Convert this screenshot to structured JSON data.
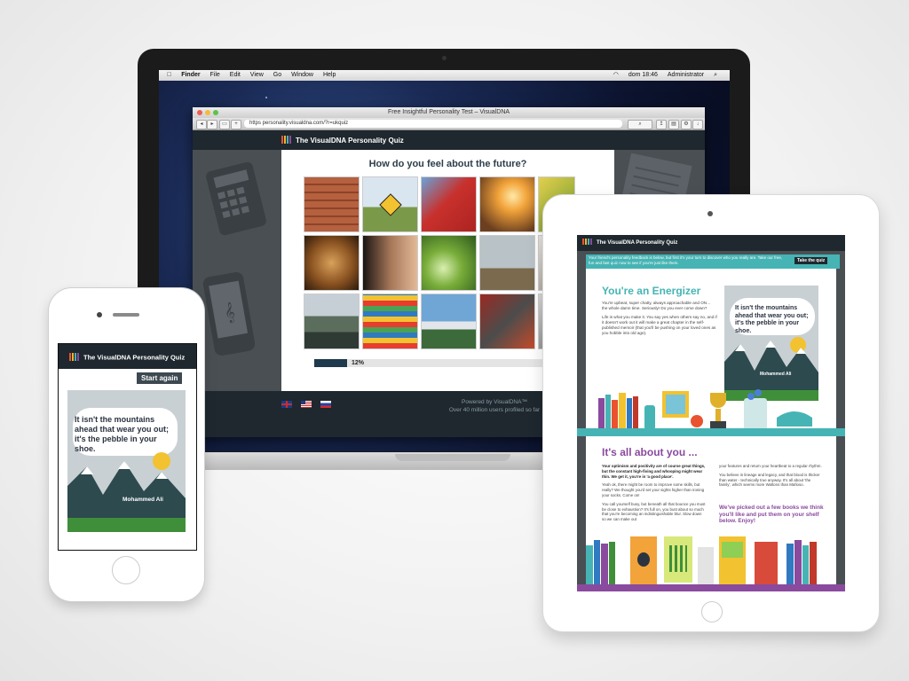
{
  "laptop": {
    "menubar": {
      "apple": "",
      "items": [
        "Finder",
        "File",
        "Edit",
        "View",
        "Go",
        "Window",
        "Help"
      ],
      "clock": "dom 18:46",
      "user": "Administrator"
    },
    "browser": {
      "window_title": "Free Insightful Personality Test – VisualDNA",
      "url": "https  personality.visualdna.com/?r=ukquiz",
      "site_title": "The VisualDNA Personality Quiz",
      "question": "How do you feel about the future?",
      "progress_label": "12%",
      "progress_value": 0.12,
      "footer_powered": "Powered by VisualDNA™",
      "footer_users": "Over 40 million users profiled so far"
    }
  },
  "tablet": {
    "site_title": "The VisualDNA Personality Quiz",
    "banner_text": "Your friend's personality feedback is below, but first it's your turn to discover who you really are. Take our free, fun and fast quiz now to see if you're just like them.",
    "banner_button": "Take the quiz",
    "energizer_title": "You're an Energizer",
    "energizer_p1": "You're upbeat, super chatty, always approachable and ON… the whole damn time. Seriously! Do you ever come down?",
    "energizer_p2": "Life is what you make it. You say yes when others say no, and if it doesn't work out it will make a great chapter in the self-published memoir (that you'll be pushing on your loved ones as you hobble into old age).",
    "quote": "It isn't the mountains ahead that wear you out; it's the pebble in your shoe.",
    "quote_author": "Mohammed Ali",
    "about_title": "It's all about you ...",
    "about_col1_lead": "Your optimism and positivity are of course great things, but the constant high-fiving and whooping might wear thin. We get it, you're in 'a good place'.",
    "about_col1_p2": "Yeah ok, there might be room to improve some skills, but really? We thought you'd set your sights higher than ironing your socks. Come on!",
    "about_col1_p3": "You call yourself busy, but beneath all that bounce you must be close to exhaustion? It's full on, you bust about so much that you're becoming an indistinguishable blur. Slow down so we can make out",
    "about_col2_p1": "your features and return your heartbeat to a regular rhythm.",
    "about_col2_p2": "You believe in lineage and legacy, and that blood is thicker than water - technically true anyway. It's all about 'the family', which seems more Waltons than Mafioso.",
    "books_heading": "We've picked out a few books we think you'll like and put them on your shelf below. Enjoy!"
  },
  "phone": {
    "site_title": "The VisualDNA Personality Quiz",
    "start_again": "Start again",
    "quote": "It isn't the mountains ahead that wear you out; it's the pebble in your shoe.",
    "quote_author": "Mohammed Ali"
  },
  "colors": {
    "dark": "#1e282e",
    "teal": "#46b4b4",
    "purple": "#8a4a9e"
  }
}
